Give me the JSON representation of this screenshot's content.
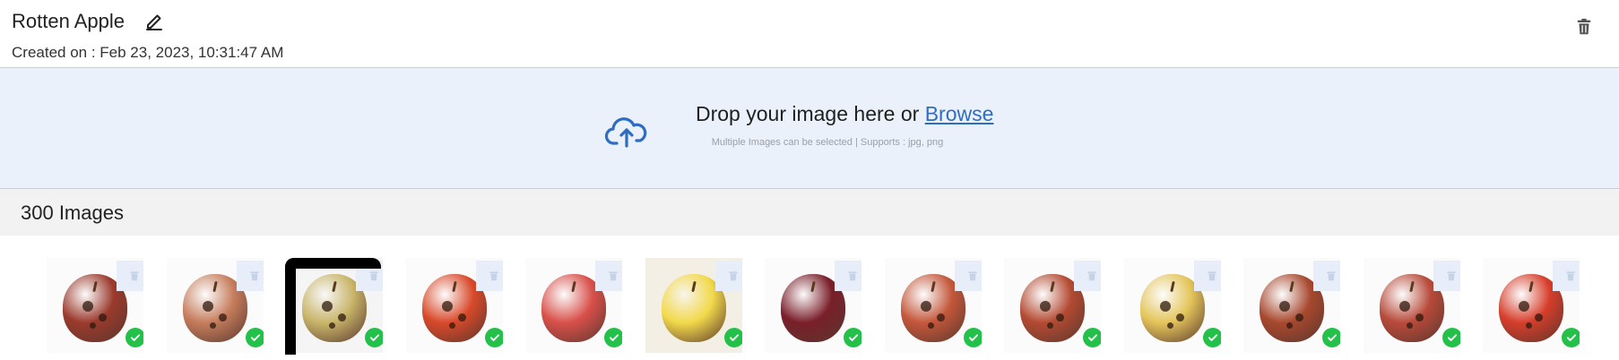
{
  "header": {
    "title": "Rotten Apple",
    "created": "Created on : Feb 23, 2023, 10:31:47 AM"
  },
  "dropzone": {
    "prompt": "Drop your image here or ",
    "browse_label": "Browse",
    "supports": "Multiple Images can be selected | Supports : jpg, png"
  },
  "gallery": {
    "count_label": "300 Images",
    "accent_check": "#24c14a",
    "thumbs": [
      {
        "apple": "#9b3a2c",
        "spots": true
      },
      {
        "apple": "#c67d5c",
        "spots": true
      },
      {
        "apple": "#c9b56a",
        "spots": true,
        "selected": true
      },
      {
        "apple": "#d9492a",
        "spots": true
      },
      {
        "apple": "#d9504a",
        "spots": false
      },
      {
        "apple": "#f2d94b",
        "spots": false,
        "tinted": true
      },
      {
        "apple": "#7a1f2a",
        "spots": false
      },
      {
        "apple": "#c4573b",
        "spots": true
      },
      {
        "apple": "#b44a32",
        "spots": true
      },
      {
        "apple": "#e4c55a",
        "spots": true
      },
      {
        "apple": "#a8482e",
        "spots": true
      },
      {
        "apple": "#b84a3a",
        "spots": true
      },
      {
        "apple": "#d63d2a",
        "spots": true
      }
    ]
  }
}
